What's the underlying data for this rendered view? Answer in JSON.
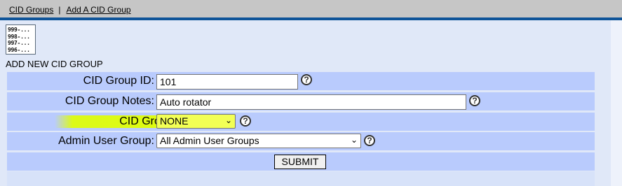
{
  "nav": {
    "cid_groups_link": "CID Groups",
    "separator": "|",
    "add_cid_group_link": "Add A CID Group"
  },
  "icon": {
    "lines": [
      "999-...",
      "998-...",
      "997-...",
      "996-..."
    ]
  },
  "form": {
    "title": "ADD NEW CID GROUP",
    "fields": {
      "cid_group_id": {
        "label": "CID Group ID:",
        "value": "101"
      },
      "cid_group_notes": {
        "label": "CID Group Notes:",
        "value": "Auto rotator"
      },
      "cid_group_type": {
        "label": "CID Group Type:",
        "value": "NONE"
      },
      "admin_user_group": {
        "label": "Admin User Group:",
        "value": "All Admin User Groups"
      }
    },
    "help_symbol": "?",
    "submit_label": "SUBMIT"
  },
  "colors": {
    "top_bar": "#c6c6c6",
    "accent_line": "#0f5499",
    "form_row": "#b9cbfd",
    "highlight": "#e0ff00"
  }
}
